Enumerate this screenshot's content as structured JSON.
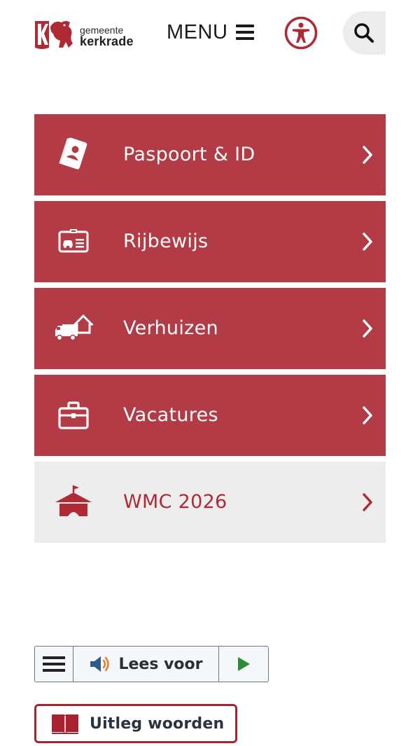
{
  "header": {
    "logo": {
      "small_text": "gemeente",
      "big_text": "kerkrade"
    },
    "menu_label": "MENU"
  },
  "tiles": [
    {
      "label": "Paspoort & ID",
      "icon": "passport-icon",
      "style": "primary"
    },
    {
      "label": "Rijbewijs",
      "icon": "driving-license-icon",
      "style": "primary"
    },
    {
      "label": "Verhuizen",
      "icon": "moving-truck-icon",
      "style": "primary"
    },
    {
      "label": "Vacatures",
      "icon": "briefcase-icon",
      "style": "primary"
    },
    {
      "label": "WMC 2026",
      "icon": "tent-icon",
      "style": "light"
    }
  ],
  "readspeaker": {
    "listen_label": "Lees voor"
  },
  "glossary": {
    "label": "Uitleg woorden"
  },
  "colors": {
    "brand_red": "#b23b45",
    "dark_red": "#a8232f",
    "light_tile": "#ededed",
    "play_green": "#2e8b3a"
  }
}
